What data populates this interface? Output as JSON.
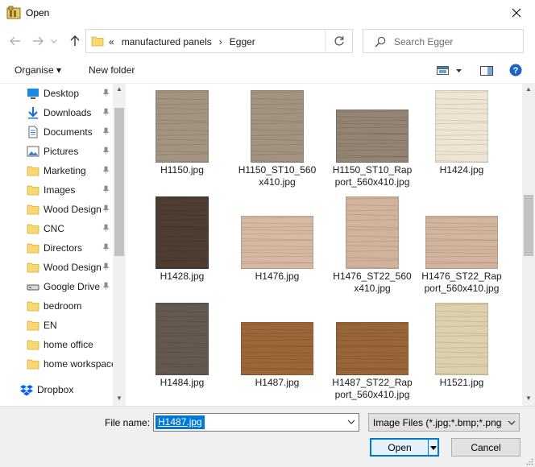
{
  "window": {
    "title": "Open"
  },
  "nav": {
    "breadcrumbs": [
      "«",
      "manufactured panels",
      "›",
      "Egger"
    ],
    "search_placeholder": "Search Egger"
  },
  "toolbar": {
    "organise_label": "Organise ▾",
    "new_folder_label": "New folder"
  },
  "sidebar": {
    "items": [
      {
        "label": "Desktop",
        "icon": "desktop-icon",
        "pinned": true
      },
      {
        "label": "Downloads",
        "icon": "download-icon",
        "pinned": true
      },
      {
        "label": "Documents",
        "icon": "document-icon",
        "pinned": true
      },
      {
        "label": "Pictures",
        "icon": "pictures-icon",
        "pinned": true
      },
      {
        "label": "Marketing",
        "icon": "folder-icon",
        "pinned": true
      },
      {
        "label": "Images",
        "icon": "folder-icon",
        "pinned": true
      },
      {
        "label": "Wood Design",
        "icon": "folder-icon",
        "pinned": true
      },
      {
        "label": "CNC",
        "icon": "folder-icon",
        "pinned": true
      },
      {
        "label": "Directors",
        "icon": "folder-icon",
        "pinned": true
      },
      {
        "label": "Wood Design",
        "icon": "folder-icon",
        "pinned": true
      },
      {
        "label": "Google Drive",
        "icon": "drive-icon",
        "pinned": true
      },
      {
        "label": "bedroom",
        "icon": "folder-icon",
        "pinned": false
      },
      {
        "label": "EN",
        "icon": "folder-icon",
        "pinned": false
      },
      {
        "label": "home office",
        "icon": "folder-icon",
        "pinned": false
      },
      {
        "label": "home workspace",
        "icon": "folder-icon",
        "pinned": false
      },
      {
        "label": "Dropbox",
        "icon": "dropbox-icon",
        "pinned": false
      }
    ]
  },
  "files": [
    {
      "name": "H1150.jpg",
      "color": "#a39481",
      "shape": "portrait"
    },
    {
      "name": "H1150_ST10_560x410.jpg",
      "color": "#a29380",
      "shape": "portrait"
    },
    {
      "name": "H1150_ST10_Rapport_560x410.jpg",
      "color": "#938473",
      "shape": "landscape"
    },
    {
      "name": "H1424.jpg",
      "color": "#ede4d3",
      "shape": "portrait"
    },
    {
      "name": "H1428.jpg",
      "color": "#4d3d32",
      "shape": "portrait"
    },
    {
      "name": "H1476.jpg",
      "color": "#d6b9a2",
      "shape": "landscape"
    },
    {
      "name": "H1476_ST22_560x410.jpg",
      "color": "#d1b39c",
      "shape": "portrait"
    },
    {
      "name": "H1476_ST22_Rapport_560x410.jpg",
      "color": "#d2b59f",
      "shape": "landscape"
    },
    {
      "name": "H1484.jpg",
      "color": "#645950",
      "shape": "portrait"
    },
    {
      "name": "H1487.jpg",
      "color": "#9c6638",
      "shape": "landscape"
    },
    {
      "name": "H1487_ST22_Rapport_560x410.jpg",
      "color": "#9a6539",
      "shape": "landscape"
    },
    {
      "name": "H1521.jpg",
      "color": "#ddd0ad",
      "shape": "portrait"
    }
  ],
  "bottom": {
    "file_name_label": "File name:",
    "file_name_value": "H1487.jpg",
    "file_type": "Image Files (*.jpg;*.bmp;*.png;*",
    "open_label": "Open",
    "cancel_label": "Cancel"
  },
  "colors": {
    "accent": "#0078d7",
    "folder": "#f8d775"
  }
}
